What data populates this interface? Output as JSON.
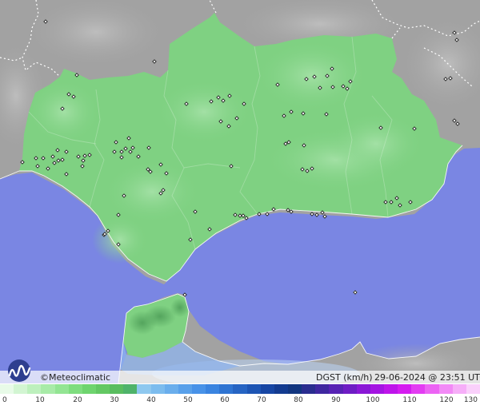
{
  "branding": {
    "copyright_symbol": "©",
    "name": "Meteoclimatic"
  },
  "legend": {
    "variable": "DGST",
    "unit": "(km/h)",
    "timestamp": "29-06-2024 @ 23:51 UTC",
    "ticks": [
      "0",
      "10",
      "20",
      "30",
      "40",
      "50",
      "60",
      "70",
      "80",
      "90",
      "100",
      "110",
      "120",
      "130"
    ],
    "scale_colors": [
      "#e8fbe8",
      "#d2f5d2",
      "#bdf0bd",
      "#a8eba8",
      "#93e593",
      "#7edd7e",
      "#6ed46e",
      "#63c863",
      "#59bd5f",
      "#4fb36a",
      "#8ec8ef",
      "#7cbcee",
      "#6aaeec",
      "#58a0ea",
      "#4892e8",
      "#3a84e0",
      "#2f74d2",
      "#2664c3",
      "#1d55b4",
      "#1746a4",
      "#133b90",
      "#123680",
      "#2a2d8f",
      "#3f27a0",
      "#5722b4",
      "#6e1cc4",
      "#8a17d6",
      "#a414e2",
      "#be14ea",
      "#d51cf0",
      "#e33cf2",
      "#ec63f4",
      "#f28af6",
      "#f6aef8",
      "#fad0fb"
    ]
  },
  "colors": {
    "sea": "#7a86e3",
    "terrain_gray": "#a2a2a2",
    "land_green": "#7fd182",
    "coast_line": "#ffffff",
    "station_marker": "#222222"
  },
  "stations": [
    [
      57,
      27
    ],
    [
      193,
      77
    ],
    [
      96,
      94
    ],
    [
      86,
      118
    ],
    [
      92,
      121
    ],
    [
      78,
      136
    ],
    [
      233,
      130
    ],
    [
      264,
      127
    ],
    [
      273,
      122
    ],
    [
      279,
      126
    ],
    [
      287,
      120
    ],
    [
      305,
      130
    ],
    [
      276,
      152
    ],
    [
      286,
      158
    ],
    [
      296,
      148
    ],
    [
      347,
      106
    ],
    [
      383,
      99
    ],
    [
      393,
      96
    ],
    [
      409,
      95
    ],
    [
      415,
      86
    ],
    [
      416,
      109
    ],
    [
      400,
      110
    ],
    [
      429,
      108
    ],
    [
      434,
      111
    ],
    [
      438,
      102
    ],
    [
      408,
      143
    ],
    [
      355,
      145
    ],
    [
      364,
      140
    ],
    [
      379,
      142
    ],
    [
      518,
      161
    ],
    [
      476,
      160
    ],
    [
      568,
      41
    ],
    [
      571,
      50
    ],
    [
      557,
      99
    ],
    [
      563,
      98
    ],
    [
      568,
      151
    ],
    [
      572,
      155
    ],
    [
      161,
      173
    ],
    [
      166,
      185
    ],
    [
      157,
      186
    ],
    [
      152,
      190
    ],
    [
      143,
      190
    ],
    [
      163,
      190
    ],
    [
      145,
      178
    ],
    [
      186,
      185
    ],
    [
      173,
      196
    ],
    [
      152,
      197
    ],
    [
      112,
      194
    ],
    [
      98,
      196
    ],
    [
      104,
      201
    ],
    [
      106,
      195
    ],
    [
      72,
      188
    ],
    [
      83,
      190
    ],
    [
      66,
      196
    ],
    [
      68,
      204
    ],
    [
      73,
      201
    ],
    [
      78,
      200
    ],
    [
      60,
      211
    ],
    [
      54,
      198
    ],
    [
      47,
      208
    ],
    [
      45,
      198
    ],
    [
      28,
      203
    ],
    [
      83,
      218
    ],
    [
      103,
      208
    ],
    [
      185,
      212
    ],
    [
      188,
      215
    ],
    [
      208,
      217
    ],
    [
      201,
      206
    ],
    [
      204,
      238
    ],
    [
      201,
      242
    ],
    [
      155,
      245
    ],
    [
      361,
      178
    ],
    [
      357,
      180
    ],
    [
      380,
      182
    ],
    [
      384,
      214
    ],
    [
      378,
      212
    ],
    [
      390,
      211
    ],
    [
      289,
      208
    ],
    [
      244,
      265
    ],
    [
      294,
      269
    ],
    [
      300,
      270
    ],
    [
      308,
      273
    ],
    [
      304,
      270
    ],
    [
      324,
      268
    ],
    [
      334,
      268
    ],
    [
      342,
      262
    ],
    [
      360,
      263
    ],
    [
      364,
      265
    ],
    [
      390,
      268
    ],
    [
      396,
      269
    ],
    [
      403,
      266
    ],
    [
      406,
      271
    ],
    [
      482,
      253
    ],
    [
      489,
      253
    ],
    [
      496,
      248
    ],
    [
      500,
      257
    ],
    [
      513,
      253
    ],
    [
      130,
      294
    ],
    [
      148,
      269
    ],
    [
      135,
      289
    ],
    [
      148,
      306
    ],
    [
      131,
      293
    ],
    [
      262,
      287
    ],
    [
      238,
      300
    ],
    [
      231,
      369
    ],
    [
      444,
      366
    ]
  ]
}
